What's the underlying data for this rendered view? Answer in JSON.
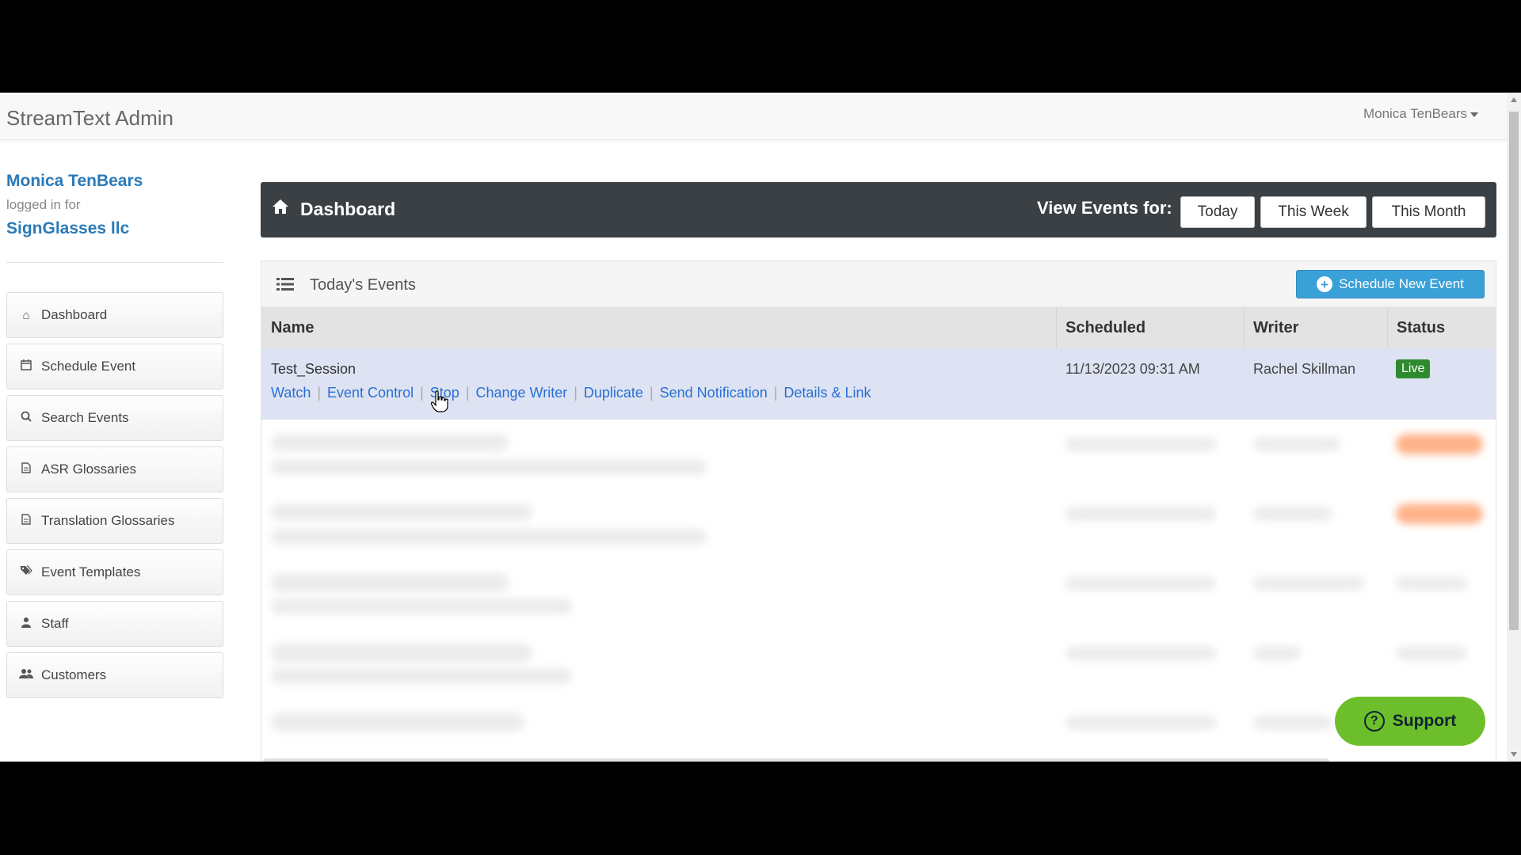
{
  "navbar": {
    "brand": "StreamText Admin",
    "user_menu_label": "Monica TenBears"
  },
  "sidebar": {
    "user_name": "Monica TenBears",
    "logged_in_text": "logged in for",
    "organization": "SignGlasses llc",
    "items": [
      {
        "label": "Dashboard",
        "icon": "home-icon"
      },
      {
        "label": "Schedule Event",
        "icon": "calendar-icon"
      },
      {
        "label": "Search Events",
        "icon": "search-icon"
      },
      {
        "label": "ASR Glossaries",
        "icon": "document-icon"
      },
      {
        "label": "Translation Glossaries",
        "icon": "document-icon"
      },
      {
        "label": "Event Templates",
        "icon": "tags-icon"
      },
      {
        "label": "Staff",
        "icon": "user-icon"
      },
      {
        "label": "Customers",
        "icon": "users-icon"
      }
    ]
  },
  "header": {
    "title": "Dashboard",
    "view_label": "View Events for:",
    "buttons": [
      "Today",
      "This Week",
      "This Month"
    ]
  },
  "panel": {
    "title": "Today's Events",
    "schedule_button": "Schedule New Event",
    "columns": [
      "Name",
      "Scheduled",
      "Writer",
      "Status"
    ]
  },
  "event": {
    "name": "Test_Session",
    "links": [
      "Watch",
      "Event Control",
      "Stop",
      "Change Writer",
      "Duplicate",
      "Send Notification",
      "Details & Link"
    ],
    "scheduled": "11/13/2023 09:31 AM",
    "writer": "Rachel Skillman",
    "status": "Live"
  },
  "support": {
    "label": "Support"
  },
  "colors": {
    "header_bg": "#3b4045",
    "primary_blue": "#3aa0d8",
    "link_blue": "#2a6fd6",
    "live_green": "#2f8a2f",
    "support_green": "#6cbf2a",
    "selected_row": "#dde3f2"
  }
}
